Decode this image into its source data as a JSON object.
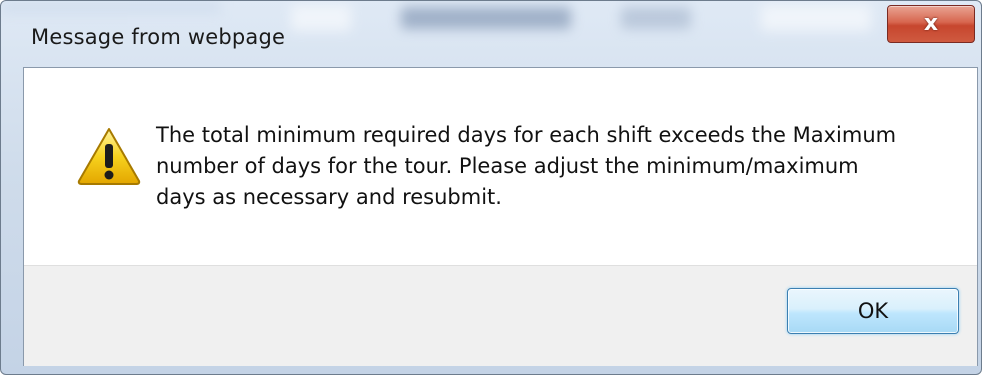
{
  "window": {
    "title": "Message from webpage",
    "close_glyph": "x",
    "close_icon": "close-icon"
  },
  "message": {
    "icon": "warning-icon",
    "icon_color": "#f2c200",
    "text": "The total minimum required days for each shift exceeds the Maximum\nnumber of days for the tour.  Please adjust the minimum/maximum\ndays as necessary and resubmit."
  },
  "buttons": {
    "ok_label": "OK"
  },
  "colors": {
    "close_button": "#c7462e",
    "ok_button_border": "#3c7fb1",
    "button_area": "#f0f0f0"
  }
}
